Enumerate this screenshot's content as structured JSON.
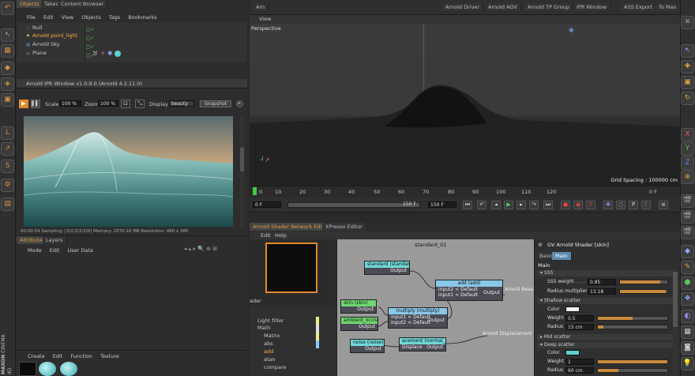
{
  "objects_manager": {
    "tabs": [
      "Objects",
      "Takes",
      "Content Browser"
    ],
    "menu": [
      "File",
      "Edit",
      "View",
      "Objects",
      "Tags",
      "Bookmarks"
    ],
    "items": [
      "Null",
      "Arnold point_light",
      "Arnold Sky",
      "Plane"
    ]
  },
  "viewport": {
    "tabs": [
      "Arn",
      "Arnold Driver",
      "Arnold AOV",
      "Arnold TP Group",
      "IPR Window",
      "ASS Export",
      "To Man"
    ],
    "tab_view": "View",
    "label": "Perspective",
    "grid_spacing": "Grid Spacing : 100000 cm"
  },
  "timeline": {
    "ticks": [
      "0",
      "10",
      "20",
      "30",
      "40",
      "50",
      "60",
      "70",
      "80",
      "90",
      "100",
      "110",
      "120"
    ],
    "frame_end_label": "0 F",
    "start": "0 F",
    "end": "150 F",
    "range_end": "150 F"
  },
  "ipr": {
    "title": "Arnold IPR Window v1.0.9.0 (Arnold 4.2.11.0)",
    "scale_label": "Scale",
    "scale_value": "100 %",
    "zoom_label": "Zoom",
    "zoom_value": "100 %",
    "display_label": "Display",
    "display_value": "beauty",
    "snapshot_label": "Snapshot",
    "status": "00:00:59  Sampling: [3/2/2/2/2/0]  Memory: 2070.16 MB  Resolution: 480 x 380"
  },
  "attributes": {
    "tabs": [
      "Attributes",
      "Layers"
    ],
    "menu": [
      "Mode",
      "Edit",
      "User Data"
    ]
  },
  "material_manager": {
    "menu": [
      "Create",
      "Edit",
      "Function",
      "Texture"
    ]
  },
  "shader_editor": {
    "tabs": [
      "Arnold Shader Network Editor",
      "XPresso Editor"
    ],
    "menu": [
      "Edit",
      "Help"
    ],
    "canvas_title": "standard_01",
    "tree_header": "ader",
    "tree": [
      "Light filter",
      "Math",
      "Matrix",
      "abs",
      "add",
      "atan",
      "compare"
    ],
    "nodes": {
      "standard": {
        "title": "standard (standar",
        "port": "Output"
      },
      "add": {
        "title": "add (add)",
        "in1": "input2 < Default",
        "in2": "input1 < Default",
        "out": "Output"
      },
      "skin": {
        "title": "skin (skin)",
        "port": "Output"
      },
      "multiply": {
        "title": "multiply (multiply)",
        "in1": "input1 < Default",
        "in2": "input2 < Default",
        "out": "Output"
      },
      "ambient": {
        "title": "ambient_occlusi",
        "port": "Output"
      },
      "noise": {
        "title": "noise (noise)",
        "port": "Output"
      },
      "displacement": {
        "title": "acement (normal_d",
        "in": "Displace",
        "out": "Output"
      }
    },
    "labels": {
      "beauty": "Arnold Beauty",
      "displacement": "Arnold Displacement"
    }
  },
  "attr_panel": {
    "title": "GV Arnold Shader [skin]",
    "tabs": [
      "Basic",
      "Main"
    ],
    "section": "Main",
    "groups": {
      "sss": "SSS",
      "shallow": "Shallow scatter",
      "mid": "Mid scatter",
      "deep": "Deep scatter"
    },
    "rows": {
      "sss_weight": {
        "label": "SSS weight . . . . . .",
        "value": "0.85",
        "level": 0.85
      },
      "radius_mult": {
        "label": "Radius multiplier",
        "value": "13.18",
        "level": 0.97
      },
      "shallow_color": {
        "label": "Color",
        "color": "#f0f0f0"
      },
      "shallow_weight": {
        "label": "Weight",
        "value": "0.5",
        "level": 0.5
      },
      "shallow_radius": {
        "label": "Radius",
        "value": "15 cm",
        "level": 0.08
      },
      "deep_color": {
        "label": "Color",
        "color": "#5fd0d0"
      },
      "deep_weight": {
        "label": "Weight",
        "value": "1",
        "level": 1.0
      },
      "deep_radius": {
        "label": "Radius",
        "value": "60 cm",
        "level": 0.3
      }
    }
  },
  "branding": {
    "line1": "MAXON",
    "line2": "CINEMA 4D"
  },
  "colors": {
    "accent": "#e08a2a",
    "highlight_text": "#ffb040",
    "cyan": "#5fd0d0"
  }
}
